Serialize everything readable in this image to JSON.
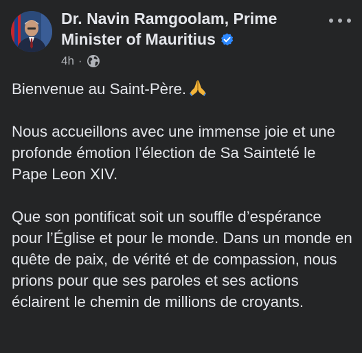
{
  "post": {
    "author": "Dr. Navin Ramgoolam, Prime Minister of Mauritius",
    "time": "4h",
    "separator": "·",
    "audience_icon": "globe-icon",
    "verified_icon": "verified-badge-icon",
    "more_icon": "more-options-icon",
    "paragraphs": [
      {
        "text": "Bienvenue au Saint-Père.",
        "emoji": "praying-hands-icon"
      },
      {
        "text": "Nous accueillons avec une immense joie et une profonde émotion l’élection de Sa Sainteté le Pape Leon XIV."
      },
      {
        "text": "Que son pontificat soit un souffle d’espérance pour l’Église et pour le monde. Dans un monde en quête de paix, de vérité et de compassion, nous prions pour que ses paroles et ses actions éclairent le chemin de millions de croyants."
      }
    ]
  },
  "colors": {
    "background": "#242526",
    "primary_text": "#e4e6eb",
    "secondary_text": "#b0b3b8",
    "verified_blue": "#2d88ff"
  }
}
